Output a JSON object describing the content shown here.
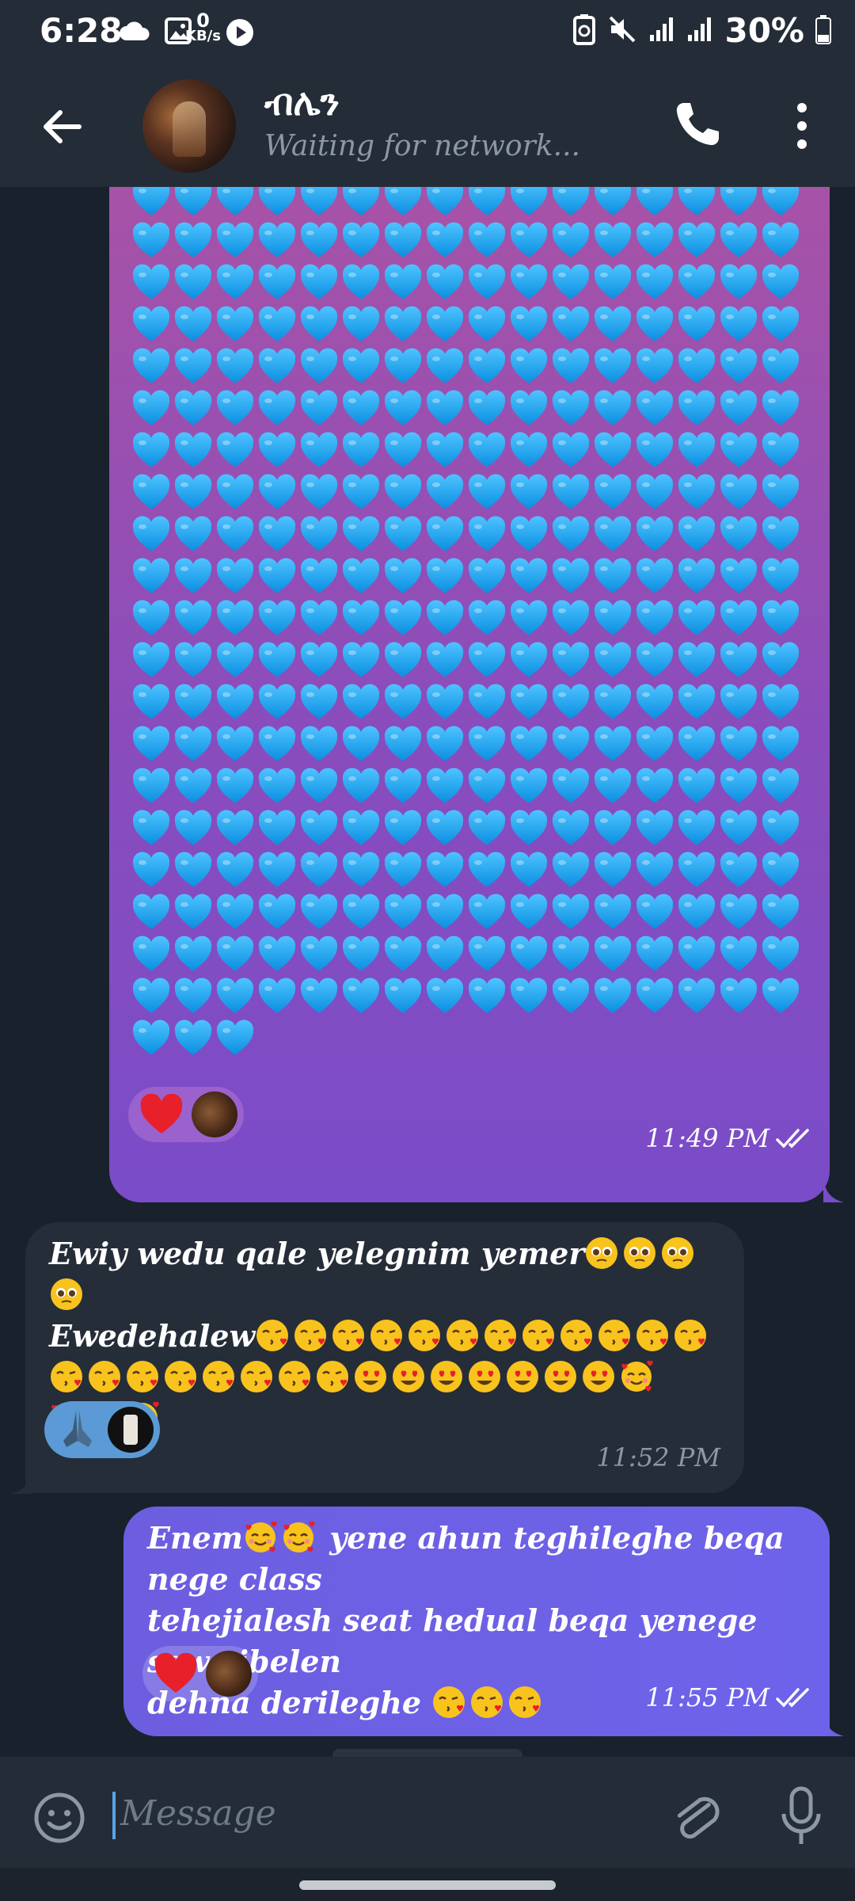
{
  "status_bar": {
    "time": "6:28",
    "net_speed_value": "0",
    "net_speed_unit": "KB/s",
    "battery": "30%",
    "icons": [
      "cloud-icon",
      "gallery-icon",
      "play-icon",
      "battery-saver-icon",
      "mute-icon",
      "signal-icon",
      "signal-icon",
      "battery-icon"
    ]
  },
  "header": {
    "name": "ብሌን",
    "status": "Waiting for network..."
  },
  "messages": [
    {
      "direction": "outgoing",
      "content": "blue hearts",
      "heart_count": 323,
      "reaction": "heart",
      "time": "11:49 PM",
      "read": true
    },
    {
      "direction": "incoming",
      "lines": [
        {
          "text": "Ewiy wedu qale yelegnim yemer",
          "emojis": [
            "pleading",
            "pleading",
            "pleading",
            "pleading"
          ]
        },
        {
          "text": "Ewedehalew",
          "emojis": [
            "kiss",
            "kiss",
            "kiss",
            "kiss",
            "kiss",
            "kiss",
            "kiss",
            "kiss",
            "kiss",
            "kiss",
            "kiss",
            "kiss"
          ]
        },
        {
          "text": "",
          "emojis": [
            "kiss",
            "kiss",
            "kiss",
            "kiss",
            "kiss",
            "kiss",
            "kiss",
            "kiss",
            "heart-eyes",
            "heart-eyes",
            "heart-eyes",
            "heart-eyes",
            "heart-eyes",
            "heart-eyes",
            "heart-eyes",
            "smiling-hearts"
          ]
        },
        {
          "text": "",
          "emojis": [
            "smiling-hearts",
            "smiling-hearts",
            "smiling-hearts"
          ]
        }
      ],
      "reaction": "folded-hands",
      "time": "11:52 PM"
    },
    {
      "direction": "outgoing",
      "line1_prefix": "Enem",
      "line1_suffix": " yene ahun teghileghe beqa nege class",
      "line2": "tehejialesh seat hedual beqa yenege sew yibelen",
      "line3": "dehna derileghe ",
      "reaction": "heart",
      "time": "11:55 PM",
      "read": true
    }
  ],
  "composer": {
    "placeholder": "Message"
  },
  "colors": {
    "header_bg": "#242c37",
    "chat_bg": "#19222c",
    "incoming_bubble": "#252d38",
    "outgoing_bubble": "#6d5ee0",
    "heart_blue": "#1ea6ef",
    "accent": "#5aa3e8"
  }
}
